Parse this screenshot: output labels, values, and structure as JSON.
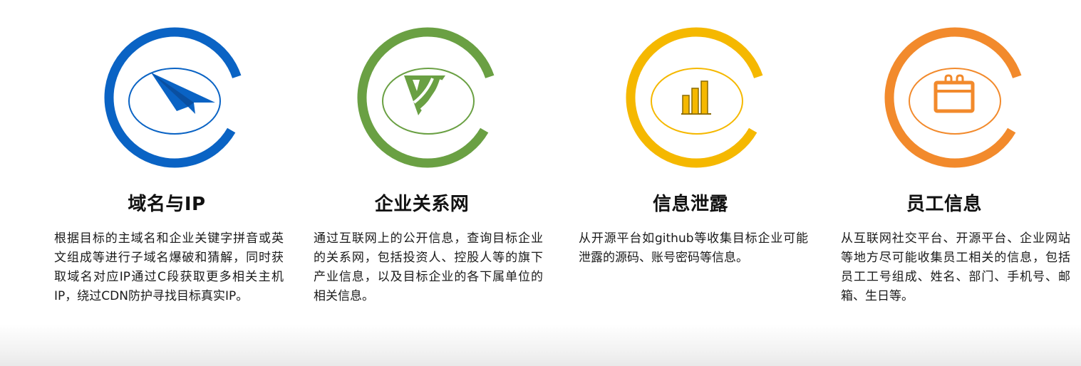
{
  "colors": {
    "blue": "#0a63c4",
    "green": "#6aa043",
    "yellow": "#f5b800",
    "orange": "#f28a2c"
  },
  "cards": [
    {
      "id": "domain-ip",
      "icon": "paper-plane-icon",
      "color": "#0a63c4",
      "title": "域名与IP",
      "description": "根据目标的主域名和企业关键字拼音或英文组成等进行子域名爆破和猜解，同时获取域名对应IP通过C段获取更多相关主机IP，绕过CDN防护寻找目标真实IP。"
    },
    {
      "id": "enterprise-network",
      "icon": "wifi-wedge-icon",
      "color": "#6aa043",
      "title": "企业关系网",
      "description": "通过互联网上的公开信息，查询目标企业的关系网，包括投资人、控股人等的旗下产业信息，以及目标企业的各下属单位的相关信息。"
    },
    {
      "id": "info-leak",
      "icon": "bar-chart-icon",
      "color": "#f5b800",
      "title": "信息泄露",
      "description": "从开源平台如github等收集目标企业可能泄露的源码、账号密码等信息。"
    },
    {
      "id": "staff-info",
      "icon": "calendar-icon",
      "color": "#f28a2c",
      "title": "员工信息",
      "description": "从互联网社交平台、开源平台、企业网站等地方尽可能收集员工相关的信息，包括员工工号组成、姓名、部门、手机号、邮箱、生日等。"
    }
  ]
}
